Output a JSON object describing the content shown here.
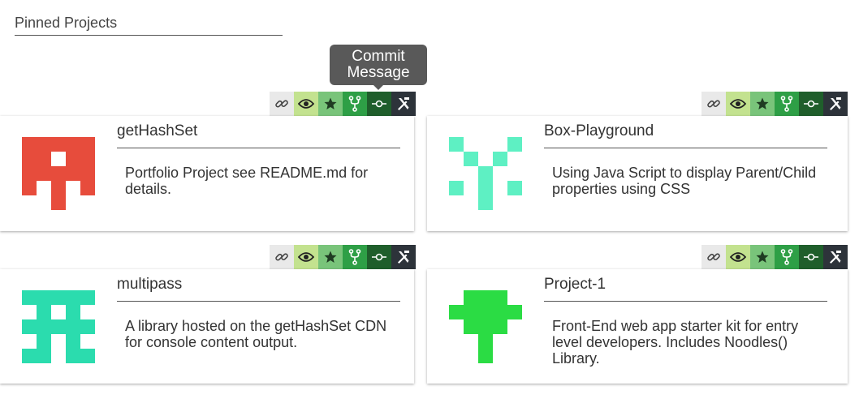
{
  "section": {
    "title": "Pinned Projects"
  },
  "tooltip": {
    "line1": "Commit",
    "line2": "Message"
  },
  "colors": {
    "link": "#e9e9e9",
    "watch": "#c3e28f",
    "star": "#79c47a",
    "fork": "#2e9f46",
    "commit": "#1f5e2b",
    "tools": "#2d333a"
  },
  "projects": [
    {
      "name": "getHashSet",
      "description": "Portfolio Project see README.md for details.",
      "avatar_color": "#e74c3c"
    },
    {
      "name": "Box-Playground",
      "description": "Using Java Script to display Parent/Child properties using CSS",
      "avatar_color": "#5ef0c3"
    },
    {
      "name": "multipass",
      "description": "A library hosted on the getHashSet CDN for console content output.",
      "avatar_color": "#2bdcae"
    },
    {
      "name": "Project-1",
      "description": "Front-End web app starter kit for entry level developers. Includes Noodles() Library.",
      "avatar_color": "#2bdc44"
    }
  ],
  "toolbar_icons": [
    "link-icon",
    "eye-icon",
    "star-icon",
    "fork-icon",
    "commit-icon",
    "tools-icon"
  ]
}
